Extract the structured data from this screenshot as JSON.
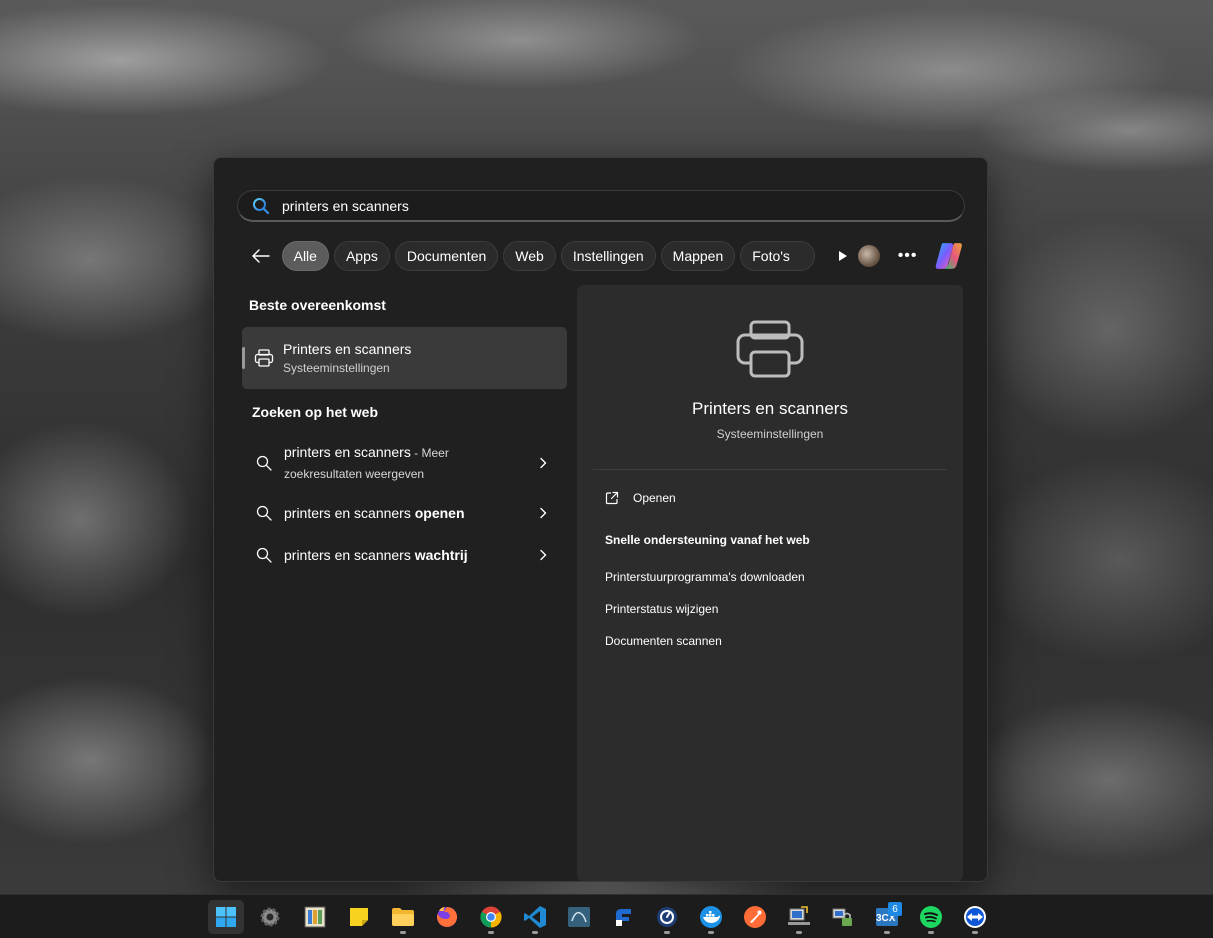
{
  "search": {
    "value": "printers en scanners",
    "placeholder": ""
  },
  "filters": {
    "chips": [
      "Alle",
      "Apps",
      "Documenten",
      "Web",
      "Instellingen",
      "Mappen",
      "Foto's"
    ],
    "active": "Alle"
  },
  "results": {
    "best_match_title": "Beste overeenkomst",
    "best_match": {
      "title": "Printers en scanners",
      "subtitle": "Systeeminstellingen"
    },
    "web_title": "Zoeken op het web",
    "web_items": [
      {
        "main": "printers en scanners",
        "suffix": " - Meer",
        "second_line": "zoekresultaten weergeven"
      },
      {
        "main": "printers en scanners ",
        "bold": "openen"
      },
      {
        "main": "printers en scanners ",
        "bold": "wachtrij"
      }
    ]
  },
  "detail": {
    "title": "Printers en scanners",
    "subtitle": "Systeeminstellingen",
    "open_label": "Openen",
    "quick_support_title": "Snelle ondersteuning vanaf het web",
    "links": [
      "Printerstuurprogramma's downloaden",
      "Printerstatus wijzigen",
      "Documenten scannen"
    ]
  },
  "taskbar": {
    "badge_3cx": "6",
    "label_3cx": "3CX",
    "icons": [
      "start-icon",
      "settings-icon",
      "app-grid-icon",
      "sticky-notes-icon",
      "file-explorer-icon",
      "firefox-icon",
      "chrome-icon",
      "vscode-icon",
      "mysql-workbench-icon",
      "onenote-like-icon",
      "motrix-icon",
      "docker-icon",
      "postman-icon",
      "network-tool-icon",
      "network-lock-icon",
      "3cx-icon",
      "spotify-icon",
      "teamviewer-icon"
    ]
  },
  "colors": {
    "panel_bg": "#202020",
    "detail_bg": "#2c2c2c",
    "active_chip": "#5c5c5c",
    "taskbar_bg": "#1c1c1c"
  }
}
